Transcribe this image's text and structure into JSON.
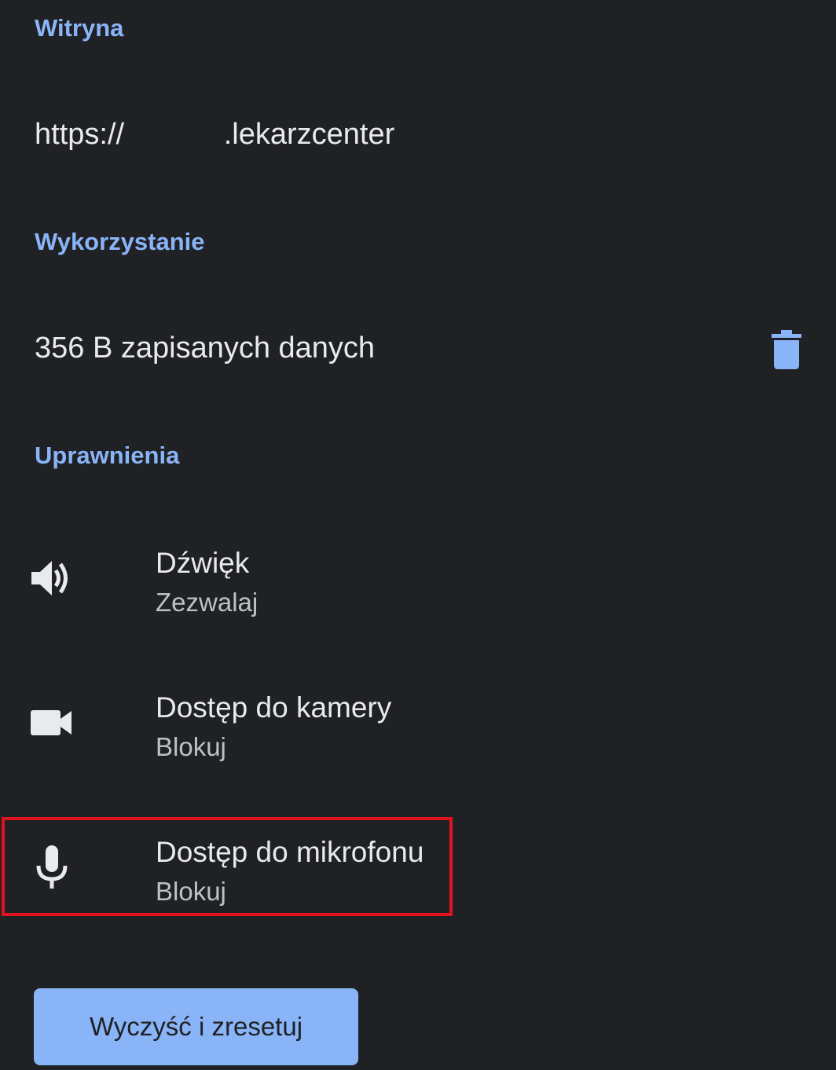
{
  "sections": {
    "site": {
      "header": "Witryna",
      "origin": "https://            .lekarzcenter"
    },
    "usage": {
      "header": "Wykorzystanie",
      "stored_text": "356 B zapisanych danych",
      "delete_icon": "trash-icon"
    },
    "permissions": {
      "header": "Uprawnienia",
      "items": [
        {
          "title": "Dźwięk",
          "status": "Zezwalaj",
          "icon": "sound-icon"
        },
        {
          "title": "Dostęp do kamery",
          "status": "Blokuj",
          "icon": "camera-icon"
        },
        {
          "title": "Dostęp do mikrofonu",
          "status": "Blokuj",
          "icon": "microphone-icon"
        }
      ]
    }
  },
  "reset_button": {
    "label": "Wyczyść i zresetuj"
  },
  "colors": {
    "background": "#202124",
    "accent": "#8ab4f8",
    "text_primary": "#e8eaed",
    "text_secondary": "#bdc1c6",
    "highlight": "#e0141c"
  }
}
